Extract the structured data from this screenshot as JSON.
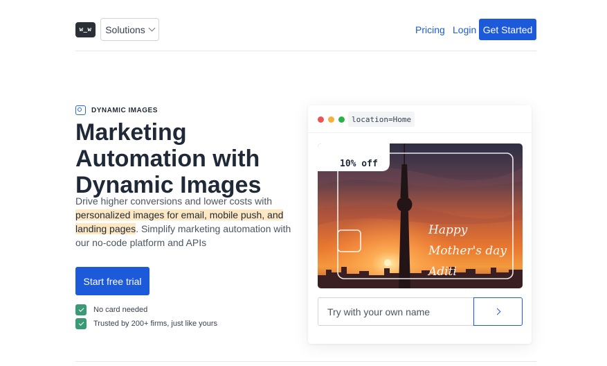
{
  "header": {
    "logo_text": "w_w",
    "solutions_label": "Solutions",
    "pricing_label": "Pricing",
    "login_label": "Login",
    "get_started_label": "Get Started"
  },
  "hero": {
    "eyebrow": "DYNAMIC IMAGES",
    "title": "Marketing Automation with Dynamic Images",
    "desc_pre": "Drive higher conversions and lower costs with ",
    "desc_highlight": "personalized images for email, mobile push, and landing pages",
    "desc_post": ". Simplify marketing automation with our no-code platform and APIs",
    "cta_label": "Start free trial",
    "checks": [
      "No card needed",
      "Trusted by 200+ firms, just like yours"
    ]
  },
  "demo": {
    "url_chip": "location=Home",
    "dot_colors": [
      "#ef5350",
      "#f5b13d",
      "#2bb34a"
    ],
    "badge_text": "10% off",
    "greeting_lines": [
      "Happy",
      "Mother's day",
      "Aditi"
    ],
    "input_placeholder": "Try with your own name"
  },
  "colors": {
    "accent": "#1d5ad9",
    "check_green": "#3a9a76",
    "highlight": "#fde8c3"
  }
}
